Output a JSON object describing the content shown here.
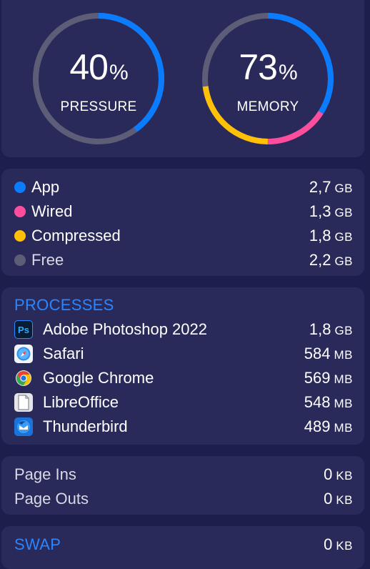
{
  "gauges": {
    "pressure": {
      "value": "40",
      "unit": "%",
      "label": "PRESSURE",
      "fraction": 0.4,
      "color": "#0a7cff",
      "track_color": "#5d5d78"
    },
    "memory": {
      "value": "73",
      "unit": "%",
      "label": "MEMORY",
      "segments": [
        {
          "name": "App",
          "fraction": 0.34,
          "color": "#0a7cff"
        },
        {
          "name": "Wired",
          "fraction": 0.16,
          "color": "#ff4d9d"
        },
        {
          "name": "Compressed",
          "fraction": 0.23,
          "color": "#ffc107"
        }
      ],
      "track_color": "#5d5d78"
    }
  },
  "legend": [
    {
      "label": "App",
      "value": "2,7",
      "unit": "GB",
      "color": "#0a7cff"
    },
    {
      "label": "Wired",
      "value": "1,3",
      "unit": "GB",
      "color": "#ff4d9d"
    },
    {
      "label": "Compressed",
      "value": "1,8",
      "unit": "GB",
      "color": "#ffc107"
    },
    {
      "label": "Free",
      "value": "2,2",
      "unit": "GB",
      "color": "#5d5d78"
    }
  ],
  "processes": {
    "title": "PROCESSES",
    "items": [
      {
        "name": "Adobe Photoshop 2022",
        "value": "1,8",
        "unit": "GB",
        "icon": "photoshop-icon",
        "icon_text": "Ps"
      },
      {
        "name": "Safari",
        "value": "584",
        "unit": "MB",
        "icon": "safari-icon"
      },
      {
        "name": "Google Chrome",
        "value": "569",
        "unit": "MB",
        "icon": "chrome-icon"
      },
      {
        "name": "LibreOffice",
        "value": "548",
        "unit": "MB",
        "icon": "libreoffice-icon"
      },
      {
        "name": "Thunderbird",
        "value": "489",
        "unit": "MB",
        "icon": "thunderbird-icon"
      }
    ]
  },
  "paging": [
    {
      "label": "Page Ins",
      "value": "0",
      "unit": "KB"
    },
    {
      "label": "Page Outs",
      "value": "0",
      "unit": "KB"
    }
  ],
  "swap": {
    "title": "SWAP",
    "value": "0",
    "unit": "KB"
  }
}
